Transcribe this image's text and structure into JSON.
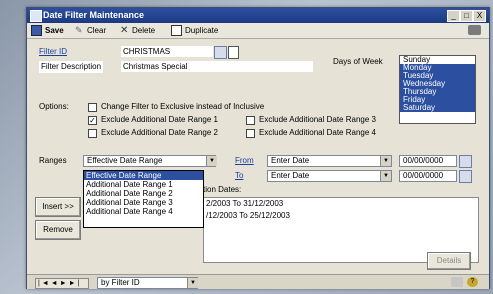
{
  "window": {
    "title": "Date Filter Maintenance",
    "minimize": "_",
    "restore": "□",
    "close": "X"
  },
  "toolbar": {
    "save": "Save",
    "clear": "Clear",
    "delete": "Delete",
    "duplicate": "Duplicate"
  },
  "form": {
    "filter_id_label": "Filter ID",
    "filter_id_value": "CHRISTMAS",
    "filter_desc_label": "Filter Description",
    "filter_desc_value": "Christmas Special",
    "days_label": "Days of Week",
    "days": [
      {
        "label": "Sunday",
        "selected": false
      },
      {
        "label": "Monday",
        "selected": true
      },
      {
        "label": "Tuesday",
        "selected": true
      },
      {
        "label": "Wednesday",
        "selected": true
      },
      {
        "label": "Thursday",
        "selected": true
      },
      {
        "label": "Friday",
        "selected": true
      },
      {
        "label": "Saturday",
        "selected": true
      }
    ],
    "options_label": "Options:",
    "opt_change_filter": {
      "label": "Change Filter to Exclusive instead of Inclusive",
      "checked": false
    },
    "opt_range1": {
      "label": "Exclude Additional Date Range 1",
      "checked": true
    },
    "opt_range2": {
      "label": "Exclude Additional Date Range 2",
      "checked": false
    },
    "opt_range3": {
      "label": "Exclude Additional Date Range 3",
      "checked": false
    },
    "opt_range4": {
      "label": "Exclude Additional Date Range 4",
      "checked": false
    },
    "ranges_label": "Ranges",
    "ranges_value": "Effective Date Range",
    "ranges_options": [
      "Effective Date Range",
      "Additional Date Range 1",
      "Additional Date Range 2",
      "Additional Date Range 3",
      "Additional Date Range 4"
    ],
    "from_label": "From",
    "from_type": "Enter Date",
    "from_date": "00/00/0000",
    "to_label": "To",
    "to_type": "Enter Date",
    "to_date": "00/00/0000",
    "dates_label_partial": "tion Dates:",
    "dates_lines": [
      "2/2003 To 31/12/2003",
      "/12/2003 To 25/12/2003"
    ],
    "insert_button": "Insert >>",
    "remove_button": "Remove",
    "details_button": "Details"
  },
  "bottom": {
    "nav_first": "|◄",
    "nav_prev": "◄",
    "nav_next": "►",
    "nav_last": "►|",
    "sort_value": "by Filter ID"
  },
  "colors": {
    "title_bar": "#1c3a83",
    "selection": "#2c4f9f",
    "link": "#1c3fa3",
    "window_bg": "#e6e3d6"
  }
}
